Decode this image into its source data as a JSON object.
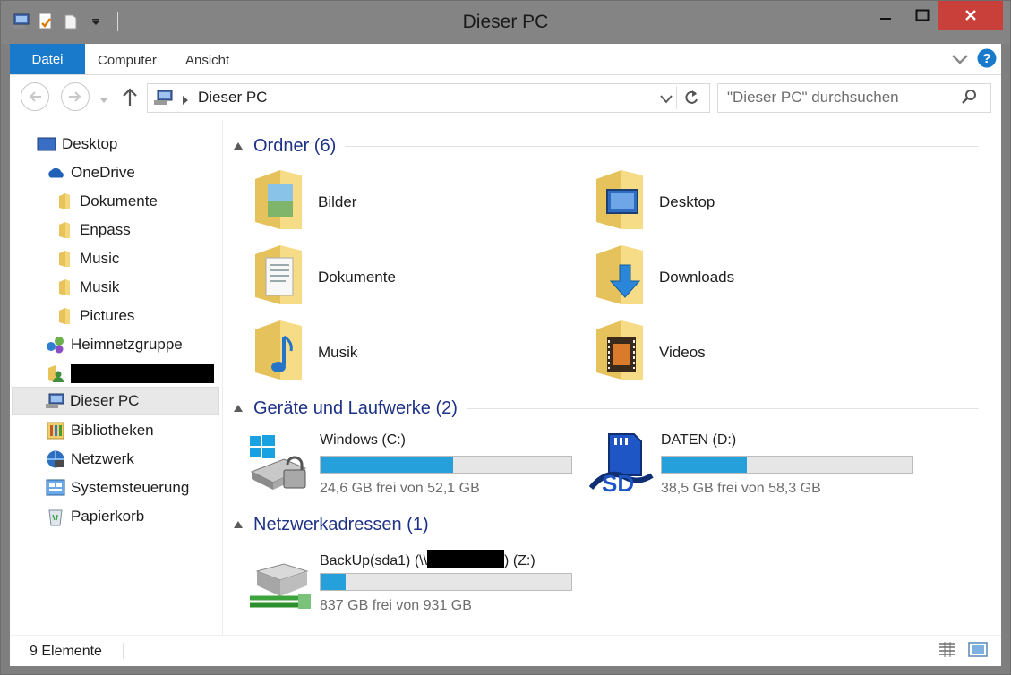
{
  "window": {
    "title": "Dieser PC"
  },
  "ribbon": {
    "tabs": [
      {
        "label": "Datei",
        "active": true
      },
      {
        "label": "Computer"
      },
      {
        "label": "Ansicht"
      }
    ]
  },
  "address": {
    "path": "Dieser PC",
    "search_placeholder": "\"Dieser PC\" durchsuchen"
  },
  "nav": {
    "items": [
      {
        "label": "Desktop",
        "icon": "desktop-icon"
      },
      {
        "label": "OneDrive",
        "icon": "onedrive-icon"
      },
      {
        "label": "Dokumente",
        "icon": "folder-icon"
      },
      {
        "label": "Enpass",
        "icon": "folder-icon"
      },
      {
        "label": "Music",
        "icon": "folder-icon"
      },
      {
        "label": "Musik",
        "icon": "folder-icon"
      },
      {
        "label": "Pictures",
        "icon": "folder-icon"
      },
      {
        "label": "Heimnetzgruppe",
        "icon": "homegroup-icon"
      },
      {
        "label": "",
        "icon": "user-folder-icon",
        "redacted": true
      },
      {
        "label": "Dieser PC",
        "icon": "computer-icon",
        "selected": true
      },
      {
        "label": "Bibliotheken",
        "icon": "libraries-icon"
      },
      {
        "label": "Netzwerk",
        "icon": "network-icon"
      },
      {
        "label": "Systemsteuerung",
        "icon": "control-panel-icon"
      },
      {
        "label": "Papierkorb",
        "icon": "recycle-bin-icon"
      }
    ]
  },
  "groups": {
    "folders": {
      "title": "Ordner (6)",
      "items": [
        {
          "label": "Bilder",
          "icon": "pictures-folder-icon"
        },
        {
          "label": "Desktop",
          "icon": "desktop-folder-icon"
        },
        {
          "label": "Dokumente",
          "icon": "documents-folder-icon"
        },
        {
          "label": "Downloads",
          "icon": "downloads-folder-icon"
        },
        {
          "label": "Musik",
          "icon": "music-folder-icon"
        },
        {
          "label": "Videos",
          "icon": "videos-folder-icon"
        }
      ]
    },
    "drives": {
      "title": "Geräte und Laufwerke (2)",
      "items": [
        {
          "name": "Windows (C:)",
          "free": "24,6 GB frei von 52,1 GB",
          "used_fraction": 0.528,
          "icon": "windows-drive-icon"
        },
        {
          "name": "DATEN (D:)",
          "free": "38,5 GB frei von 58,3 GB",
          "used_fraction": 0.34,
          "icon": "sd-drive-icon"
        }
      ]
    },
    "network": {
      "title": "Netzwerkadressen (1)",
      "items": [
        {
          "name_prefix": "BackUp(sda1) (\\\\",
          "name_suffix": ") (Z:)",
          "free": "837 GB frei von 931 GB",
          "used_fraction": 0.101,
          "icon": "network-drive-icon"
        }
      ]
    }
  },
  "status": {
    "count": "9 Elemente"
  },
  "colors": {
    "accent": "#1979ca",
    "bar": "#26a0da",
    "group": "#1e3287",
    "close": "#c9403a"
  }
}
